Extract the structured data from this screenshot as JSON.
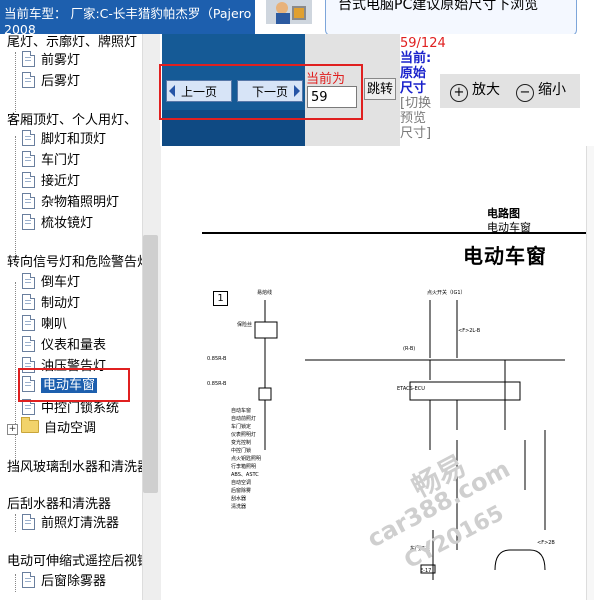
{
  "header": {
    "car_line1": "当前车型：  厂家:C-长丰猎豹帕杰罗（Pajero",
    "car_line2": "2008"
  },
  "notice": {
    "text": "台式电脑PC建议原始尺寸下浏览"
  },
  "sidebar": {
    "items": [
      {
        "type": "cat",
        "label": "尾灯、示廓灯、牌照灯"
      },
      {
        "type": "leaf",
        "label": "前雾灯"
      },
      {
        "type": "leaf",
        "label": "后雾灯"
      },
      {
        "type": "cat",
        "label": "客厢顶灯、个人用灯、"
      },
      {
        "type": "leaf",
        "label": "脚灯和顶灯"
      },
      {
        "type": "leaf",
        "label": "车门灯"
      },
      {
        "type": "leaf",
        "label": "接近灯"
      },
      {
        "type": "leaf",
        "label": "杂物箱照明灯"
      },
      {
        "type": "leaf",
        "label": "梳妆镜灯"
      },
      {
        "type": "cat",
        "label": "转向信号灯和危险警告灯"
      },
      {
        "type": "leaf",
        "label": "倒车灯"
      },
      {
        "type": "leaf",
        "label": "制动灯"
      },
      {
        "type": "leaf",
        "label": "喇叭"
      },
      {
        "type": "leaf",
        "label": "仪表和量表"
      },
      {
        "type": "leaf",
        "label": "油压警告灯"
      },
      {
        "type": "leaf",
        "label": "电动车窗",
        "selected": true
      },
      {
        "type": "leaf",
        "label": "中控门锁系统"
      },
      {
        "type": "folder",
        "label": "自动空调"
      },
      {
        "type": "cat",
        "label": "挡风玻璃刮水器和清洗器"
      },
      {
        "type": "cat",
        "label": "后刮水器和清洗器"
      },
      {
        "type": "leaf",
        "label": "前照灯清洗器"
      },
      {
        "type": "cat",
        "label": "电动可伸缩式遥控后视镜"
      },
      {
        "type": "leaf",
        "label": "后窗除雾器"
      }
    ]
  },
  "toolbar": {
    "prev_label": "上一页",
    "next_label": "下一页",
    "current_label": "当前为",
    "page_value": "59",
    "jump_label": "跳转",
    "page_info": {
      "fraction": "59/124",
      "current_prefix": "当前:",
      "original_size": "原始尺寸",
      "switch_size": "[切换预览尺寸]"
    },
    "zoom_in": "放大",
    "zoom_out": "缩小"
  },
  "document": {
    "section": "电路图",
    "subsection": "电动车窗",
    "title": "电动车窗",
    "figure_number": "1"
  },
  "watermark": {
    "text1": "畅易",
    "text2": "car388.com",
    "text3": "CY20165"
  },
  "colors": {
    "header_blue": "#1d5fae",
    "control_blue": "#155a96",
    "highlight_red": "#e02020",
    "link_blue": "#1a22cc"
  }
}
